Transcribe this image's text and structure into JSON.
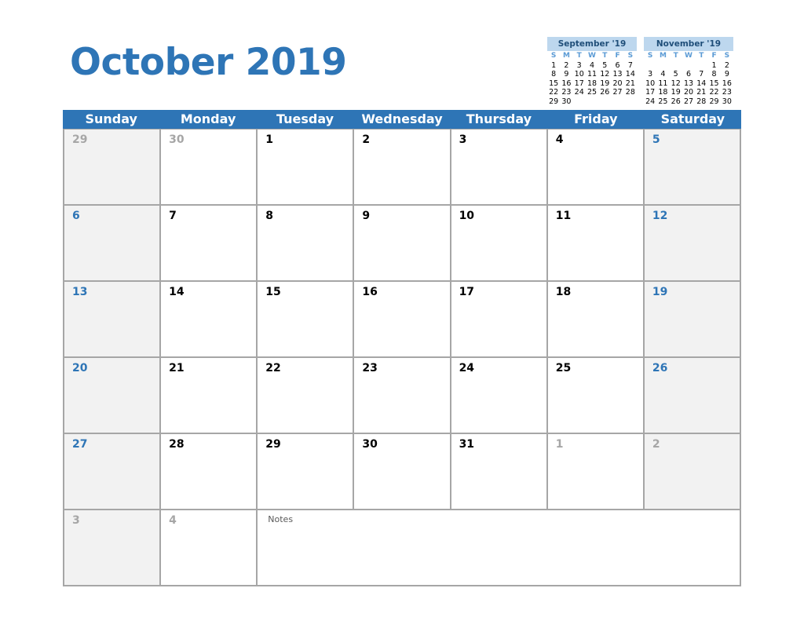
{
  "title": "October 2019",
  "colors": {
    "accent": "#2E75B6",
    "mini_header_bg": "#BDD7EE",
    "weekend_bg": "#F2F2F2",
    "other_month": "#A6A6A6"
  },
  "mini_calendars": [
    {
      "title": "September '19",
      "dow": [
        "S",
        "M",
        "T",
        "W",
        "T",
        "F",
        "S"
      ],
      "weeks": [
        [
          "1",
          "2",
          "3",
          "4",
          "5",
          "6",
          "7"
        ],
        [
          "8",
          "9",
          "10",
          "11",
          "12",
          "13",
          "14"
        ],
        [
          "15",
          "16",
          "17",
          "18",
          "19",
          "20",
          "21"
        ],
        [
          "22",
          "23",
          "24",
          "25",
          "26",
          "27",
          "28"
        ],
        [
          "29",
          "30",
          "",
          "",
          "",
          "",
          ""
        ]
      ]
    },
    {
      "title": "November '19",
      "dow": [
        "S",
        "M",
        "T",
        "W",
        "T",
        "F",
        "S"
      ],
      "weeks": [
        [
          "",
          "",
          "",
          "",
          "",
          "1",
          "2"
        ],
        [
          "3",
          "4",
          "5",
          "6",
          "7",
          "8",
          "9"
        ],
        [
          "10",
          "11",
          "12",
          "13",
          "14",
          "15",
          "16"
        ],
        [
          "17",
          "18",
          "19",
          "20",
          "21",
          "22",
          "23"
        ],
        [
          "24",
          "25",
          "26",
          "27",
          "28",
          "29",
          "30"
        ]
      ]
    }
  ],
  "weekdays": [
    "Sunday",
    "Monday",
    "Tuesday",
    "Wednesday",
    "Thursday",
    "Friday",
    "Saturday"
  ],
  "weeks": [
    [
      {
        "d": "29",
        "o": true
      },
      {
        "d": "30",
        "o": true
      },
      {
        "d": "1"
      },
      {
        "d": "2"
      },
      {
        "d": "3"
      },
      {
        "d": "4"
      },
      {
        "d": "5"
      }
    ],
    [
      {
        "d": "6"
      },
      {
        "d": "7"
      },
      {
        "d": "8"
      },
      {
        "d": "9"
      },
      {
        "d": "10"
      },
      {
        "d": "11"
      },
      {
        "d": "12"
      }
    ],
    [
      {
        "d": "13"
      },
      {
        "d": "14"
      },
      {
        "d": "15"
      },
      {
        "d": "16"
      },
      {
        "d": "17"
      },
      {
        "d": "18"
      },
      {
        "d": "19"
      }
    ],
    [
      {
        "d": "20"
      },
      {
        "d": "21"
      },
      {
        "d": "22"
      },
      {
        "d": "23"
      },
      {
        "d": "24"
      },
      {
        "d": "25"
      },
      {
        "d": "26"
      }
    ],
    [
      {
        "d": "27"
      },
      {
        "d": "28"
      },
      {
        "d": "29"
      },
      {
        "d": "30"
      },
      {
        "d": "31"
      },
      {
        "d": "1",
        "o": true
      },
      {
        "d": "2",
        "o": true
      }
    ]
  ],
  "last_row": [
    {
      "d": "3",
      "o": true
    },
    {
      "d": "4",
      "o": true
    }
  ],
  "notes_label": "Notes"
}
